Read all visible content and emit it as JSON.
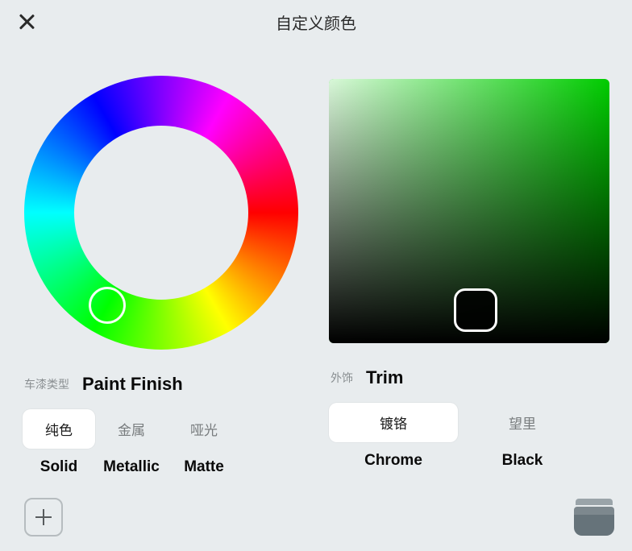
{
  "header": {
    "title": "自定义颜色"
  },
  "paint": {
    "sub_label": "车漆类型",
    "main_label": "Paint Finish",
    "options": [
      {
        "cn": "纯色",
        "en": "Solid",
        "active": true
      },
      {
        "cn": "金属",
        "en": "Metallic",
        "active": false
      },
      {
        "cn": "哑光",
        "en": "Matte",
        "active": false
      }
    ]
  },
  "trim": {
    "sub_label": "外饰",
    "main_label": "Trim",
    "options": [
      {
        "cn": "镀铬",
        "en": "Chrome",
        "active": true
      },
      {
        "cn": "望里",
        "en": "Black",
        "active": false
      }
    ]
  },
  "colors": {
    "selected_hue": "#00cc00"
  }
}
